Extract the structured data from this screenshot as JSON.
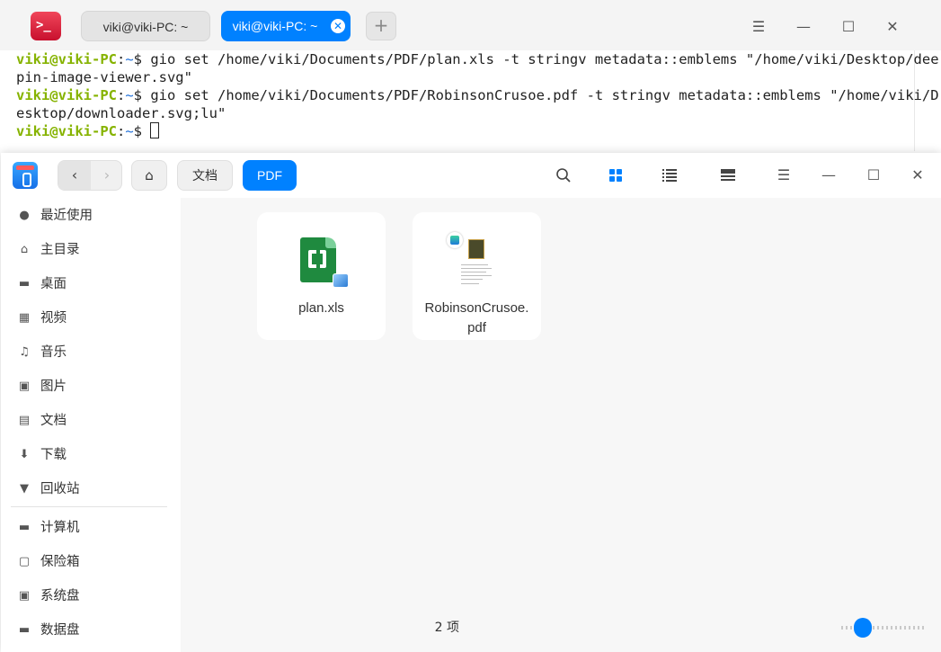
{
  "terminal": {
    "tabs": [
      {
        "label": "viki@viki-PC: ~",
        "active": false
      },
      {
        "label": "viki@viki-PC: ~",
        "active": true
      }
    ],
    "new_tab_label": "+",
    "window_controls": {
      "menu": "☰",
      "minimize": "—",
      "maximize": "☐",
      "close": "✕"
    },
    "lines": [
      {
        "user": "viki@viki-PC",
        "path": "~",
        "prompt": "$ ",
        "text": "gio set /home/viki/Documents/PDF/plan.xls -t stringv metadata::emblems \"/home/viki/Desktop/dee"
      },
      {
        "text": "pin-image-viewer.svg\""
      },
      {
        "user": "viki@viki-PC",
        "path": "~",
        "prompt": "$ ",
        "text": "gio set /home/viki/Documents/PDF/RobinsonCrusoe.pdf -t stringv metadata::emblems \"/home/viki/D"
      },
      {
        "text": "esktop/downloader.svg;lu\""
      },
      {
        "user": "viki@viki-PC",
        "path": "~",
        "prompt": "$ ",
        "text": ""
      }
    ],
    "colors": {
      "user": "#86b300",
      "path": "#1e6fd9",
      "accent": "#0081ff"
    }
  },
  "file_manager": {
    "breadcrumb": [
      {
        "label": "文档",
        "active": false
      },
      {
        "label": "PDF",
        "active": true
      }
    ],
    "sidebar": {
      "items": [
        {
          "label": "最近使用",
          "icon": "clock-icon"
        },
        {
          "label": "主目录",
          "icon": "home-icon"
        },
        {
          "label": "桌面",
          "icon": "desktop-icon"
        },
        {
          "label": "视频",
          "icon": "video-icon"
        },
        {
          "label": "音乐",
          "icon": "music-icon"
        },
        {
          "label": "图片",
          "icon": "picture-icon"
        },
        {
          "label": "文档",
          "icon": "document-icon"
        },
        {
          "label": "下载",
          "icon": "download-icon"
        },
        {
          "label": "回收站",
          "icon": "trash-icon"
        }
      ],
      "devices": [
        {
          "label": "计算机",
          "icon": "computer-icon"
        },
        {
          "label": "保险箱",
          "icon": "vault-icon"
        },
        {
          "label": "系统盘",
          "icon": "disk-icon"
        },
        {
          "label": "数据盘",
          "icon": "disk-icon"
        }
      ]
    },
    "files": [
      {
        "name": "plan.xls",
        "icon": "spreadsheet-icon",
        "emblem": "image-viewer-emblem"
      },
      {
        "name": "RobinsonCrusoe.\npdf",
        "icon": "pdf-thumbnail",
        "emblem": "downloader-emblem"
      }
    ],
    "status": "2 项",
    "zoom_level": 0.2
  }
}
